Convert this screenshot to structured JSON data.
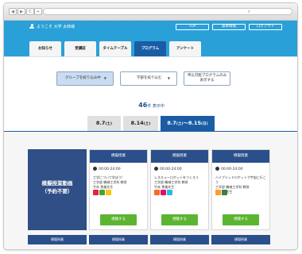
{
  "browser": {
    "back": "◀",
    "forward": "▶",
    "reload": "C",
    "add": "+",
    "search_glyph": "⌕"
  },
  "header": {
    "welcome": "ようこそ 大学 太郎様",
    "buttons": [
      "TOP",
      "基本情報",
      "ログアウト"
    ],
    "tabs": [
      "お知らせ",
      "受講証",
      "タイムテーブル",
      "プログラム",
      "アンケート"
    ],
    "active_tab_index": 3
  },
  "filters": {
    "group": "グループを絞り込み中",
    "department": "学部を絞り込む",
    "available_line1": "申込可能プログラムのみ",
    "available_line2": "表示する"
  },
  "results": {
    "count": "46",
    "suffix": "件 表示中"
  },
  "date_tabs": [
    {
      "date": "8.7",
      "dow": "(土)"
    },
    {
      "date": "8.14",
      "dow": "(土)"
    },
    {
      "date": "8.7",
      "dow": "(土)",
      "sep": "〜",
      "date2": "8.15",
      "dow2": "(日)"
    }
  ],
  "active_date_tab_index": 2,
  "category": {
    "line1": "模擬授業動画",
    "line2": "（予約不要）"
  },
  "cards": [
    {
      "head": "模擬授業",
      "time": "00:00-24:00",
      "line1": "工学について学ぼう!",
      "line2": "工学部 機械工学科 教授",
      "line3": "竹本 恵美先生",
      "button": "視聴する",
      "icons": [
        "#e5243b",
        "#4c9f38",
        "#fcc30b"
      ]
    },
    {
      "head": "模擬授業",
      "time": "00:00-24:00",
      "line1": "レスキューロボットをつくろう",
      "line2": "工学部 機械工学科 教授",
      "line3": "竹本 恵美先生",
      "button": "視聴する",
      "icons": [
        "#fd6925",
        "#dd1367",
        "#26bde2"
      ]
    },
    {
      "head": "模擬授業",
      "time": "00:00-24:00",
      "line1": "ハイブリッドロケットで宇宙に行こう",
      "line2": "工学部 機械工学科 教授",
      "line3": "糖々 中先生",
      "button": "視聴する",
      "icons": [
        "#fd9d24",
        "#3f7e44"
      ]
    }
  ],
  "bottom_strip": [
    "模擬授業",
    "模擬授業",
    "模擬授業",
    "模擬授業"
  ],
  "colors": {
    "header": "#2aa0d8",
    "navy": "#2b4f8b",
    "active": "#1a5da4",
    "button_green": "#5cb531"
  }
}
